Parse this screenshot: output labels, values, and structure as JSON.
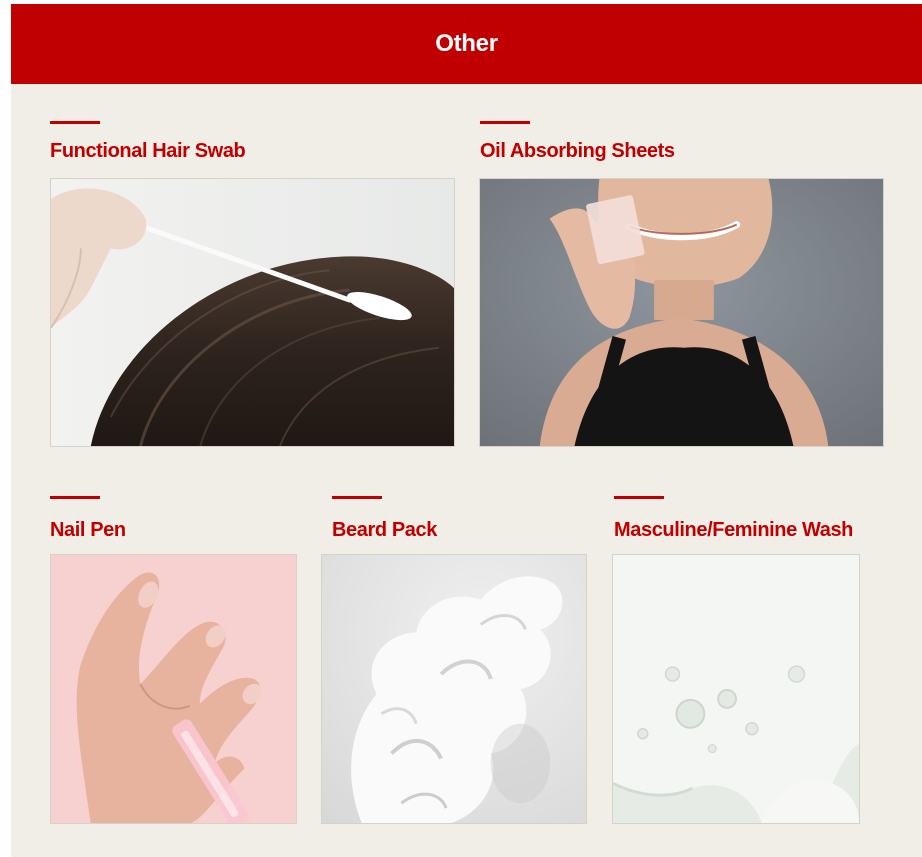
{
  "section": {
    "title": "Other"
  },
  "products": [
    {
      "label": "Functional Hair Swab",
      "image": "hair-swab-photo"
    },
    {
      "label": "Oil Absorbing Sheets",
      "image": "oil-sheets-photo"
    },
    {
      "label": "Nail Pen",
      "image": "nail-pen-photo"
    },
    {
      "label": "Beard Pack",
      "image": "beard-pack-photo"
    },
    {
      "label": "Masculine/Feminine Wash",
      "image": "wash-foam-photo"
    }
  ],
  "colors": {
    "accent": "#c00000",
    "background": "#f1ede7",
    "header_text": "#ffffff"
  }
}
